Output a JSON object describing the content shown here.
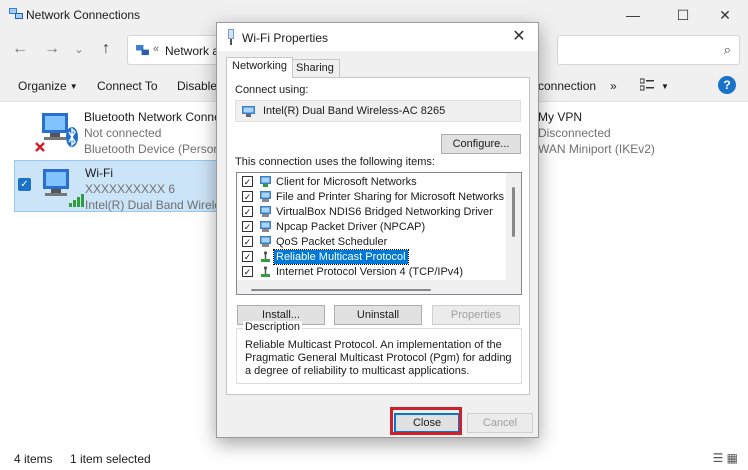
{
  "explorer": {
    "title": "Network Connections",
    "address": "Network ar",
    "toolbar": {
      "organize": "Organize",
      "connect_to": "Connect To",
      "disable": "Disable t",
      "connection": "connection",
      "more": "»"
    },
    "items": [
      {
        "name": "Bluetooth Network Connecti",
        "status": "Not connected",
        "device": "Bluetooth Device (Personal A"
      },
      {
        "name": "Wi-Fi",
        "status": "XXXXXXXXXX 6",
        "device": "Intel(R) Dual Band Wireless-A"
      },
      {
        "name": "My VPN",
        "status": "Disconnected",
        "device": "WAN Miniport (IKEv2)"
      }
    ],
    "status": {
      "count": "4 items",
      "selected": "1 item selected"
    }
  },
  "dialog": {
    "title": "Wi-Fi Properties",
    "tabs": [
      "Networking",
      "Sharing"
    ],
    "connect_using_label": "Connect using:",
    "adapter": "Intel(R) Dual Band Wireless-AC 8265",
    "configure_label": "Configure...",
    "items_label": "This connection uses the following items:",
    "items": [
      {
        "label": "Client for Microsoft Networks",
        "checked": true,
        "icon": "network-client-icon"
      },
      {
        "label": "File and Printer Sharing for Microsoft Networks",
        "checked": true,
        "icon": "network-service-icon"
      },
      {
        "label": "VirtualBox NDIS6 Bridged Networking Driver",
        "checked": true,
        "icon": "network-service-icon"
      },
      {
        "label": "Npcap Packet Driver (NPCAP)",
        "checked": true,
        "icon": "network-service-icon"
      },
      {
        "label": "QoS Packet Scheduler",
        "checked": true,
        "icon": "network-service-icon"
      },
      {
        "label": "Reliable Multicast Protocol",
        "checked": true,
        "icon": "protocol-icon",
        "selected": true
      },
      {
        "label": "Internet Protocol Version 4 (TCP/IPv4)",
        "checked": true,
        "icon": "protocol-icon"
      }
    ],
    "install_label": "Install...",
    "uninstall_label": "Uninstall",
    "properties_label": "Properties",
    "description_title": "Description",
    "description": "Reliable Multicast Protocol.  An implementation of the Pragmatic General Multicast Protocol (Pgm) for adding a degree of reliability to multicast applications.",
    "close_label": "Close",
    "cancel_label": "Cancel"
  },
  "colors": {
    "accent": "#0078d7",
    "highlight": "#d0202a",
    "selection_bg": "#cce4f7"
  }
}
